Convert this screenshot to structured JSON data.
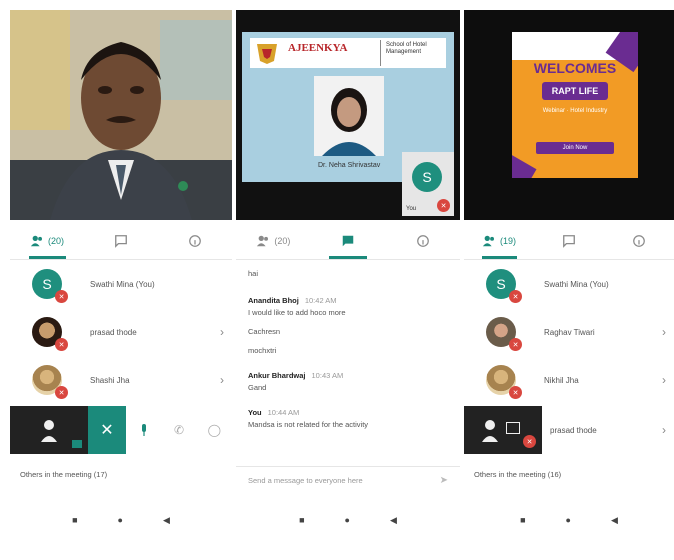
{
  "panels": [
    {
      "video": {
        "type": "camera"
      },
      "tabs": [
        {
          "icon": "people-icon",
          "label": "(20)",
          "active": true
        },
        {
          "icon": "chat-icon",
          "label": "",
          "active": false
        },
        {
          "icon": "info-icon",
          "label": "",
          "active": false
        }
      ],
      "participants": [
        {
          "avatar": "S",
          "name": "Swathi Mina (You)",
          "muted": true,
          "chevron": false
        },
        {
          "avatar": "",
          "name": "prasad thode",
          "muted": true,
          "chevron": true
        },
        {
          "avatar": "",
          "name": "Shashi Jha",
          "muted": true,
          "chevron": true
        }
      ],
      "controls": {
        "end_call": "✕"
      },
      "others_text": "Others in the meeting (17)"
    },
    {
      "slide": {
        "college_name": "AJEENKYA",
        "school_name": "School of Hotel Management",
        "caption": "Dr. Neha Shrivastav"
      },
      "self_tile": {
        "avatar": "S",
        "label": "You"
      },
      "tabs": [
        {
          "icon": "people-icon",
          "label": "(20)",
          "active": false
        },
        {
          "icon": "chat-icon",
          "label": "",
          "active": true
        },
        {
          "icon": "info-icon",
          "label": "",
          "active": false
        }
      ],
      "chat": {
        "first_line": "hai",
        "messages": [
          {
            "who": "Anandita Bhoj",
            "time": "10:42 AM",
            "lines": [
              "I would like to add hoco more",
              "Cachresn",
              "mochxtri"
            ]
          },
          {
            "who": "Ankur Bhardwaj",
            "time": "10:43 AM",
            "lines": [
              "Gand"
            ]
          },
          {
            "who": "You",
            "time": "10:44 AM",
            "lines": [
              "Mandsa is not related for the activity"
            ]
          }
        ],
        "input_placeholder": "Send a message to everyone here"
      }
    },
    {
      "poster": {
        "title": "WELCOMES",
        "badge": "RAPT LIFE",
        "sub": "Webinar · Hotel Industry",
        "button": "Join Now"
      },
      "tabs": [
        {
          "icon": "people-icon",
          "label": "(19)",
          "active": true
        },
        {
          "icon": "chat-icon",
          "label": "",
          "active": false
        },
        {
          "icon": "info-icon",
          "label": "",
          "active": false
        }
      ],
      "participants": [
        {
          "avatar": "S",
          "name": "Swathi Mina (You)",
          "muted": true,
          "chevron": false
        },
        {
          "avatar": "",
          "name": "Raghav Tiwari",
          "muted": true,
          "chevron": true
        },
        {
          "avatar": "",
          "name": "Nikhil Jha",
          "muted": true,
          "chevron": true
        },
        {
          "avatar": "",
          "name": "prasad thode",
          "muted": false,
          "chevron": true
        }
      ],
      "others_text": "Others in the meeting (16)"
    }
  ],
  "nav": {
    "back": "◀",
    "home": "●",
    "recent": "■"
  },
  "colors": {
    "accent": "#1b8a7b",
    "mute": "#d9473f",
    "poster_orange": "#f29b25",
    "poster_purple": "#6a2c91"
  }
}
